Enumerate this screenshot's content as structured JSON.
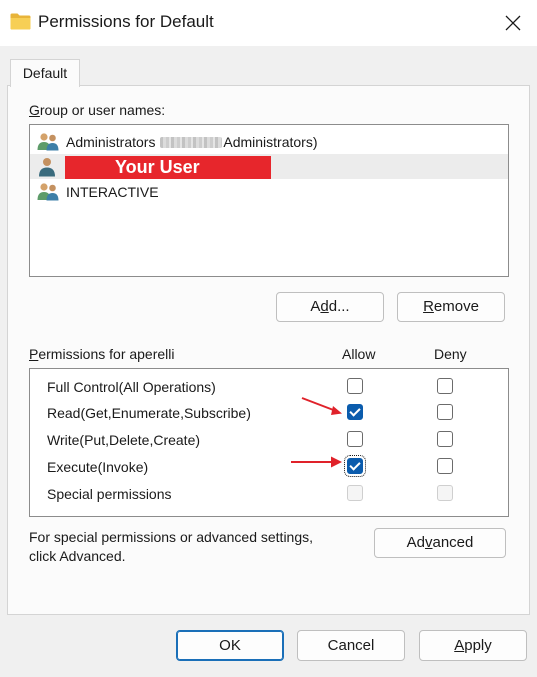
{
  "window": {
    "title": "Permissions for Default",
    "icon": "folder-icon",
    "close_icon": "close-icon"
  },
  "tabs": [
    {
      "label": "Default",
      "active": true
    }
  ],
  "group_section": {
    "label_prefix": "G",
    "label_rest": "roup or user names:",
    "users": [
      {
        "icon": "users-group-icon",
        "name_before": "Administrators ",
        "name_after": "Administrators)",
        "redacted": true
      },
      {
        "icon": "user-icon",
        "name": "Your User",
        "selected": true,
        "redaction_color": "#e7262c"
      },
      {
        "icon": "users-group-icon",
        "name": "INTERACTIVE"
      }
    ],
    "add_label_prefix": "A",
    "add_label_u": "d",
    "add_label_rest": "d...",
    "remove_label_u": "R",
    "remove_label_rest": "emove"
  },
  "permissions": {
    "label_u": "P",
    "label_rest": "ermissions for aperelli",
    "allow_header": "Allow",
    "deny_header": "Deny",
    "rows": [
      {
        "name": "Full Control(All Operations)",
        "allow": false,
        "deny": false
      },
      {
        "name": "Read(Get,Enumerate,Subscribe)",
        "allow": true,
        "deny": false
      },
      {
        "name": "Write(Put,Delete,Create)",
        "allow": false,
        "deny": false
      },
      {
        "name": "Execute(Invoke)",
        "allow": true,
        "deny": false
      },
      {
        "name": "Special permissions",
        "allow": false,
        "deny": false,
        "disabled": true
      }
    ]
  },
  "advanced_note": {
    "line1": "For special permissions or advanced settings,",
    "line2": "click Advanced.",
    "button_prefix": "Ad",
    "button_u": "v",
    "button_rest": "anced"
  },
  "footer": {
    "ok_label": "OK",
    "cancel_label": "Cancel",
    "apply_u": "A",
    "apply_rest": "pply"
  },
  "colors": {
    "accent": "#0b5cad",
    "annotation_arrow": "#e0222a"
  }
}
